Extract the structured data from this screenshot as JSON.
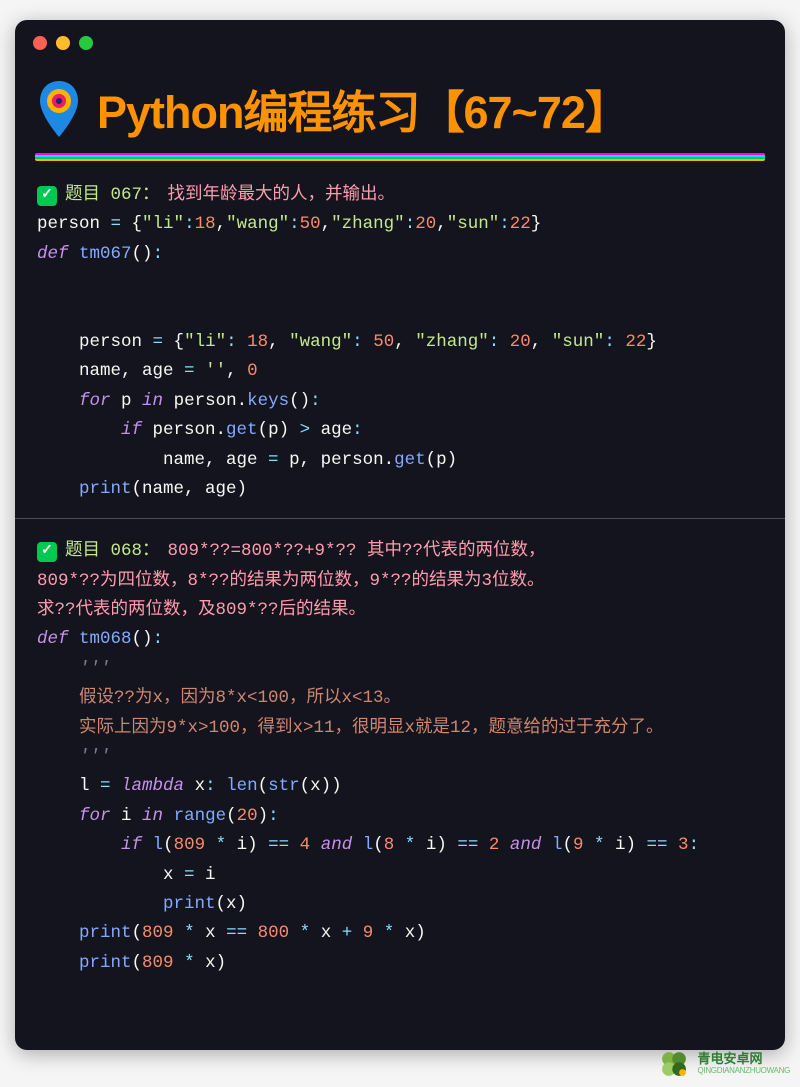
{
  "header": {
    "title": "Python编程练习【67~72】"
  },
  "problems": [
    {
      "label": "题目 067：",
      "desc": "找到年龄最大的人，并输出。",
      "preline_html": "person <span class='op'>=</span> {<span class='str'>\"li\"</span><span class='op'>:</span><span class='num'>18</span>,<span class='str'>\"wang\"</span><span class='op'>:</span><span class='num'>50</span>,<span class='str'>\"zhang\"</span><span class='op'>:</span><span class='num'>20</span>,<span class='str'>\"sun\"</span><span class='op'>:</span><span class='num'>22</span>}",
      "code_html": "<span class='kw'>def</span> <span class='fn'>tm067</span>()<span class='op'>:</span>\n\n\n    person <span class='op'>=</span> {<span class='str'>\"li\"</span><span class='op'>:</span> <span class='num'>18</span>, <span class='str'>\"wang\"</span><span class='op'>:</span> <span class='num'>50</span>, <span class='str'>\"zhang\"</span><span class='op'>:</span> <span class='num'>20</span>, <span class='str'>\"sun\"</span><span class='op'>:</span> <span class='num'>22</span>}\n    name, age <span class='op'>=</span> <span class='str'>''</span>, <span class='num'>0</span>\n    <span class='kw'>for</span> p <span class='kw'>in</span> person.<span class='fn'>keys</span>()<span class='op'>:</span>\n        <span class='kw'>if</span> person.<span class='fn'>get</span>(p) <span class='op'>&gt;</span> age<span class='op'>:</span>\n            name, age <span class='op'>=</span> p, person.<span class='fn'>get</span>(p)\n    <span class='fn'>print</span>(name, age)"
    },
    {
      "label": "题目 068：",
      "desc": "809*??=800*??+9*?? 其中??代表的两位数，",
      "desc_lines": [
        "809*??为四位数，8*??的结果为两位数，9*??的结果为3位数。",
        "求??代表的两位数，及809*??后的结果。"
      ],
      "code_html": "<span class='kw'>def</span> <span class='fn'>tm068</span>()<span class='op'>:</span>\n    <span class='comment'>'''</span>\n    <span class='commentOrange'>假设??为x，因为8*x&lt;100，所以x&lt;13。</span>\n    <span class='commentOrange'>实际上因为9*x&gt;100，得到x&gt;11，很明显x就是12，题意给的过于充分了。</span>\n    <span class='comment'>'''</span>\n    l <span class='op'>=</span> <span class='kw'>lambda</span> x<span class='op'>:</span> <span class='fn'>len</span>(<span class='fn'>str</span>(x))\n    <span class='kw'>for</span> i <span class='kw'>in</span> <span class='fn'>range</span>(<span class='num'>20</span>)<span class='op'>:</span>\n        <span class='kw'>if</span> <span class='fn'>l</span>(<span class='num'>809</span> <span class='op'>*</span> i) <span class='op'>==</span> <span class='num'>4</span> <span class='kw'>and</span> <span class='fn'>l</span>(<span class='num'>8</span> <span class='op'>*</span> i) <span class='op'>==</span> <span class='num'>2</span> <span class='kw'>and</span> <span class='fn'>l</span>(<span class='num'>9</span> <span class='op'>*</span> i) <span class='op'>==</span> <span class='num'>3</span><span class='op'>:</span>\n            x <span class='op'>=</span> i\n            <span class='fn'>print</span>(x)\n    <span class='fn'>print</span>(<span class='num'>809</span> <span class='op'>*</span> x <span class='op'>==</span> <span class='num'>800</span> <span class='op'>*</span> x <span class='op'>+</span> <span class='num'>9</span> <span class='op'>*</span> x)\n    <span class='fn'>print</span>(<span class='num'>809</span> <span class='op'>*</span> x)"
    }
  ],
  "watermark": {
    "cn": "青电安卓网",
    "en": "QINGDIANANZHUOWANG"
  }
}
